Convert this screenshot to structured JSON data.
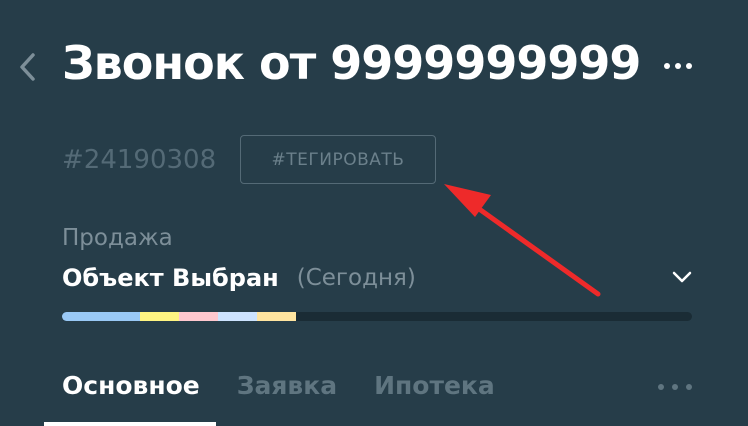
{
  "header": {
    "title": "Звонок от 9999999999",
    "back_icon": "chevron-left-icon",
    "more_icon": "more-horizontal-icon"
  },
  "deal": {
    "id": "#24190308",
    "tag_button_label": "#ТЕГИРОВАТЬ"
  },
  "pipeline": {
    "name": "Продажа",
    "stage": "Объект Выбран",
    "stage_date": "(Сегодня)",
    "chevron_icon": "chevron-down-icon"
  },
  "progress": {
    "completed_fraction": 0.37,
    "segment_colors": [
      "#99c9f5",
      "#fff582",
      "#ffc8cf",
      "#cde4ff",
      "#ffe5a0"
    ],
    "track_color": "#1a2c35"
  },
  "tabs": {
    "items": [
      {
        "label": "Основное",
        "active": true
      },
      {
        "label": "Заявка",
        "active": false
      },
      {
        "label": "Ипотека",
        "active": false
      }
    ],
    "more_icon": "more-horizontal-icon"
  },
  "colors": {
    "background": "#263d49",
    "annotation_arrow": "#ee2a2a"
  }
}
